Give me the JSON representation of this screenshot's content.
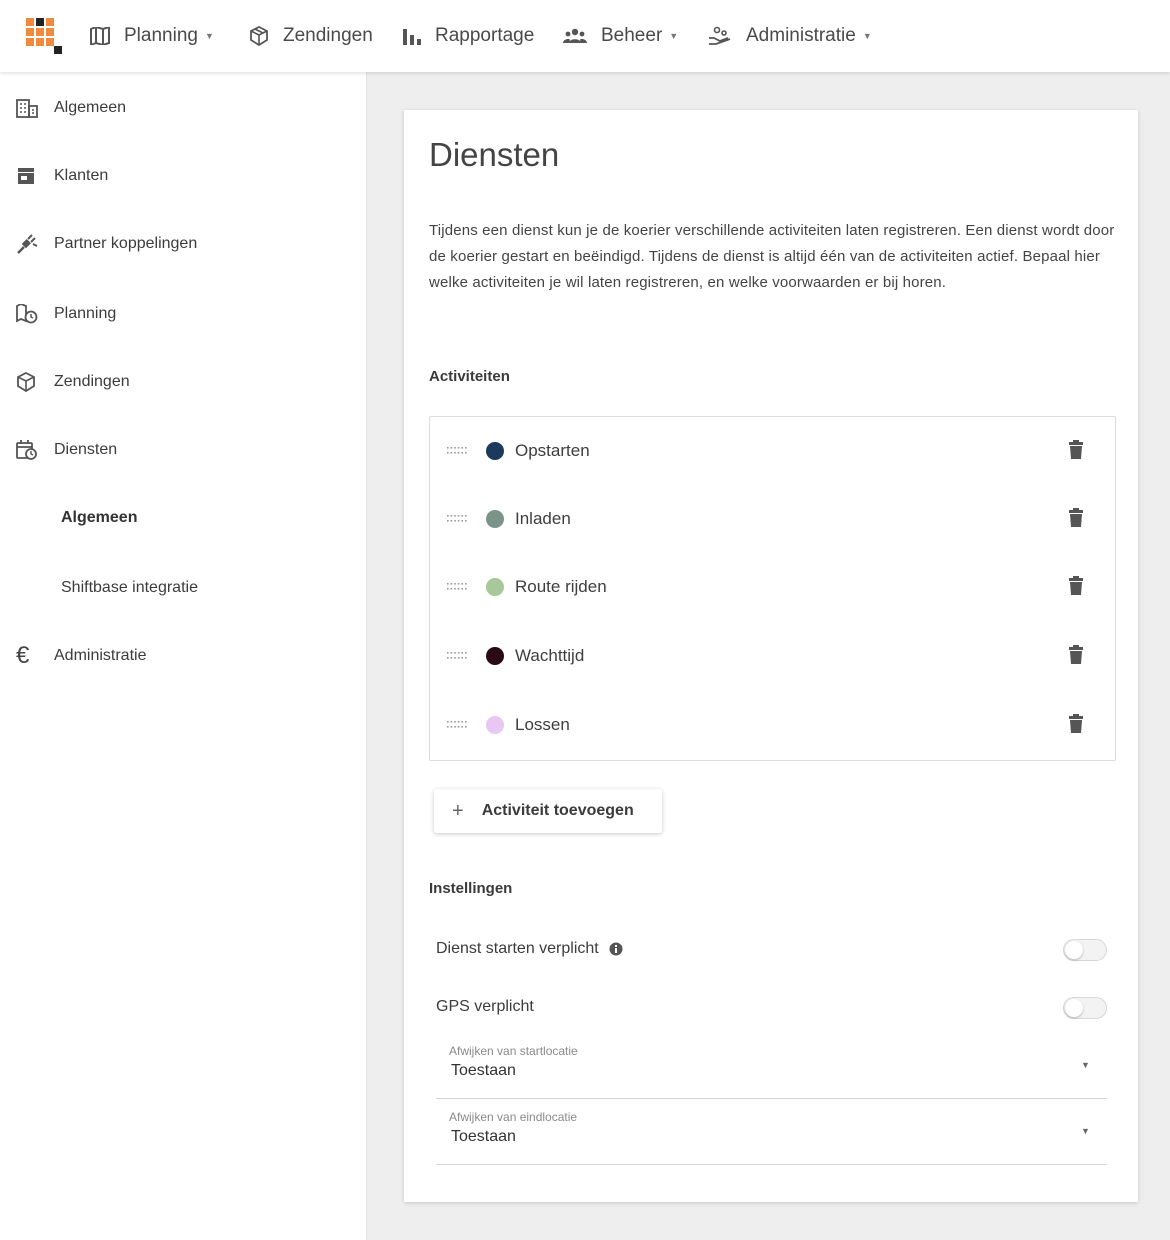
{
  "topnav": {
    "items": [
      {
        "label": "Planning",
        "icon": "map-icon",
        "dropdown": true
      },
      {
        "label": "Zendingen",
        "icon": "package-icon",
        "dropdown": false
      },
      {
        "label": "Rapportage",
        "icon": "bar-chart-icon",
        "dropdown": false
      },
      {
        "label": "Beheer",
        "icon": "people-icon",
        "dropdown": true
      },
      {
        "label": "Administratie",
        "icon": "hand-coins-icon",
        "dropdown": true
      }
    ]
  },
  "sidebar": {
    "items": [
      {
        "label": "Algemeen",
        "icon": "building-icon"
      },
      {
        "label": "Klanten",
        "icon": "store-icon"
      },
      {
        "label": "Partner koppelingen",
        "icon": "plug-icon"
      },
      {
        "label": "Planning",
        "icon": "map-clock-icon"
      },
      {
        "label": "Zendingen",
        "icon": "package-icon"
      },
      {
        "label": "Diensten",
        "icon": "calendar-clock-icon"
      },
      {
        "label": "Administratie",
        "icon": "euro-icon"
      }
    ],
    "subitems": [
      {
        "label": "Algemeen",
        "active": true
      },
      {
        "label": "Shiftbase integratie",
        "active": false
      }
    ]
  },
  "page": {
    "title": "Diensten",
    "description": "Tijdens een dienst kun je de koerier verschillende activiteiten laten registreren. Een dienst wordt door de koerier gestart en beëindigd. Tijdens de dienst is altijd één van de activiteiten actief. Bepaal hier welke activiteiten je wil laten registreren, en welke voorwaarden er bij horen."
  },
  "activities": {
    "heading": "Activiteiten",
    "items": [
      {
        "label": "Opstarten",
        "color": "#1c3a5c"
      },
      {
        "label": "Inladen",
        "color": "#7a948a"
      },
      {
        "label": "Route rijden",
        "color": "#a7c99a"
      },
      {
        "label": "Wachttijd",
        "color": "#2a0a14"
      },
      {
        "label": "Lossen",
        "color": "#e8c8f2"
      }
    ],
    "add_label": "Activiteit toevoegen"
  },
  "settings": {
    "heading": "Instellingen",
    "toggles": [
      {
        "label": "Dienst starten verplicht",
        "info": true,
        "value": false
      },
      {
        "label": "GPS verplicht",
        "info": false,
        "value": false
      }
    ],
    "selects": [
      {
        "label": "Afwijken van startlocatie",
        "value": "Toestaan"
      },
      {
        "label": "Afwijken van eindlocatie",
        "value": "Toestaan"
      }
    ]
  },
  "colors": {
    "logo_orange": "#f08a3c",
    "logo_black": "#222222",
    "main_background": "#eeeeee"
  }
}
